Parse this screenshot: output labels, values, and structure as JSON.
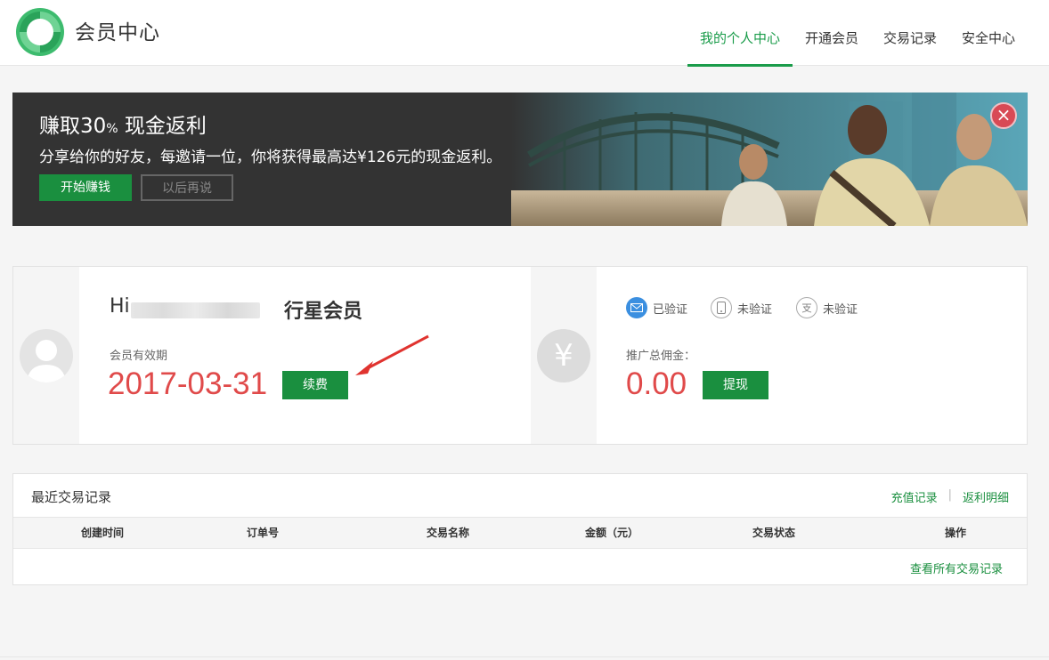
{
  "header": {
    "title": "会员中心",
    "nav": [
      "我的个人中心",
      "开通会员",
      "交易记录",
      "安全中心"
    ],
    "active_tab": "我的个人中心"
  },
  "banner": {
    "title_prefix": "赚取",
    "title_number": "30",
    "title_percent": "%",
    "title_suffix": " 现金返利",
    "description": "分享给你的好友，每邀请一位，你将获得最高达¥126元的现金返利。",
    "start_button": "开始赚钱",
    "later_button": "以后再说",
    "close_icon": "×"
  },
  "member": {
    "greeting": "Hi",
    "level": "行星会员",
    "valid_label": "会员有效期",
    "valid_date": "2017-03-31",
    "renew_button": "续费",
    "verify": [
      {
        "label": "已验证",
        "icon": "mail-icon"
      },
      {
        "label": "未验证",
        "icon": "phone-icon"
      },
      {
        "label": "未验证",
        "icon": "idcard-icon"
      }
    ],
    "promo_label": "推广总佣金：",
    "promo_value": "0.00",
    "withdraw_button": "提现",
    "yuan_symbol": "¥"
  },
  "transactions": {
    "title": "最近交易记录",
    "recharge_link": "充值记录",
    "rebate_link": "返利明细",
    "separator": "|",
    "columns": [
      "创建时间",
      "订单号",
      "交易名称",
      "金额（元）",
      "交易状态",
      "操作"
    ],
    "view_all": "查看所有交易记录"
  },
  "colors": {
    "accent": "#1a8f3f",
    "highlight": "#e04a4a",
    "banner_bg": "#333333"
  }
}
